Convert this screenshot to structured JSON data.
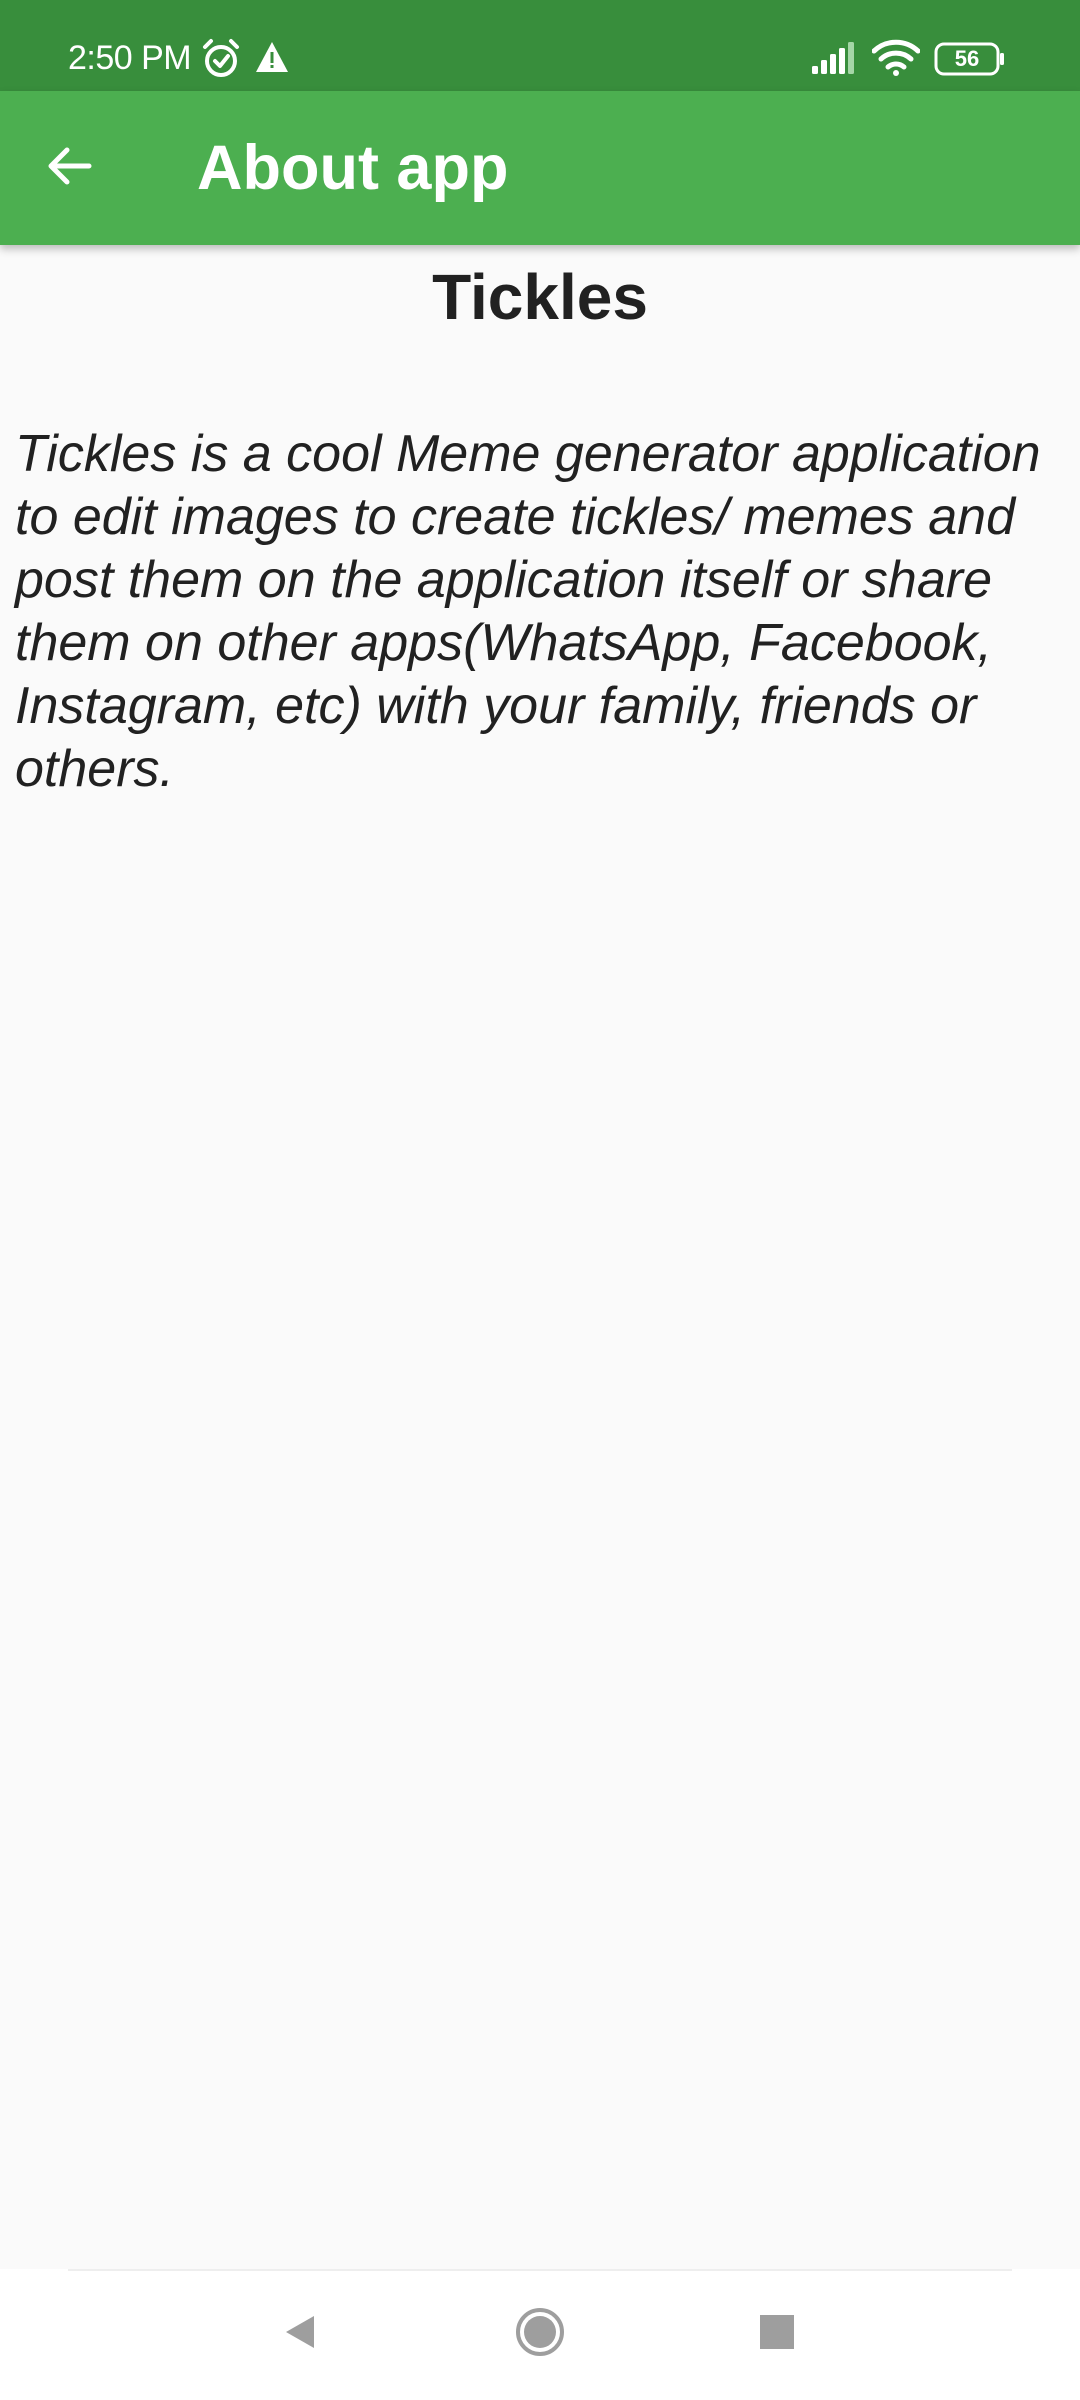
{
  "status_bar": {
    "time": "2:50 PM",
    "icons": [
      "alarm-icon",
      "warning-icon",
      "signal-icon",
      "wifi-icon",
      "battery-icon"
    ],
    "battery_level": "56"
  },
  "app_bar": {
    "back_icon": "arrow-left-icon",
    "title": "About app"
  },
  "content": {
    "title": "Tickles",
    "description": "Tickles is a cool Meme generator application to edit images to create tickles/ memes and post them on the application itself or share them on other apps(WhatsApp, Facebook, Instagram, etc) with your family, friends or others."
  },
  "nav_bar": {
    "buttons": [
      "back-triangle-icon",
      "home-circle-icon",
      "recents-square-icon"
    ]
  },
  "colors": {
    "status_bar": "#388e3c",
    "app_bar": "#4caf50",
    "background": "#fafafa",
    "text": "#212121",
    "nav_icons": "#9e9e9e"
  }
}
